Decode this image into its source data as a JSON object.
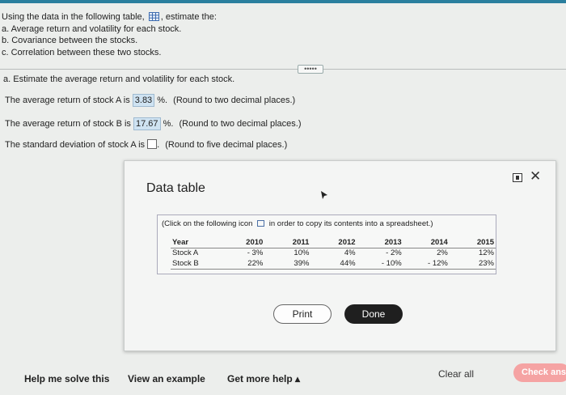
{
  "question": {
    "line1_prefix": "Using the data in the following table,",
    "line1_suffix": ", estimate the:",
    "item_a": "a. Average return and volatility for each stock.",
    "item_b": "b. Covariance between the stocks.",
    "item_c": "c. Correlation between these two stocks."
  },
  "expand_label": "•••••",
  "part_a": {
    "heading": "a. Estimate the average return and volatility for each stock.",
    "line1": {
      "prefix": "The average return of stock A is",
      "value": "3.83",
      "unit": "%.",
      "hint": "(Round to two decimal places.)"
    },
    "line2": {
      "prefix": "The average return of stock B is",
      "value": "17.67",
      "unit": "%.",
      "hint": "(Round to two decimal places.)"
    },
    "line3": {
      "prefix": "The standard deviation of stock A is",
      "unit": ".",
      "hint": "(Round to five decimal places.)"
    }
  },
  "modal": {
    "title": "Data table",
    "copy_note_prefix": "(Click on the following icon",
    "copy_note_suffix": "in order to copy its contents into a spreadsheet.)",
    "table": {
      "header": [
        "Year",
        "2010",
        "2011",
        "2012",
        "2013",
        "2014",
        "2015"
      ],
      "rows": [
        [
          "Stock A",
          "- 3%",
          "10%",
          "4%",
          "- 2%",
          "2%",
          "12%"
        ],
        [
          "Stock B",
          "22%",
          "39%",
          "44%",
          "- 10%",
          "- 12%",
          "23%"
        ]
      ]
    },
    "print_label": "Print",
    "done_label": "Done",
    "close_glyph": "✕"
  },
  "footer": {
    "help_label": "Help me solve this",
    "example_label": "View an example",
    "more_help_label": "Get more help ▴",
    "clear_label": "Clear all",
    "check_label": "Check ans"
  }
}
